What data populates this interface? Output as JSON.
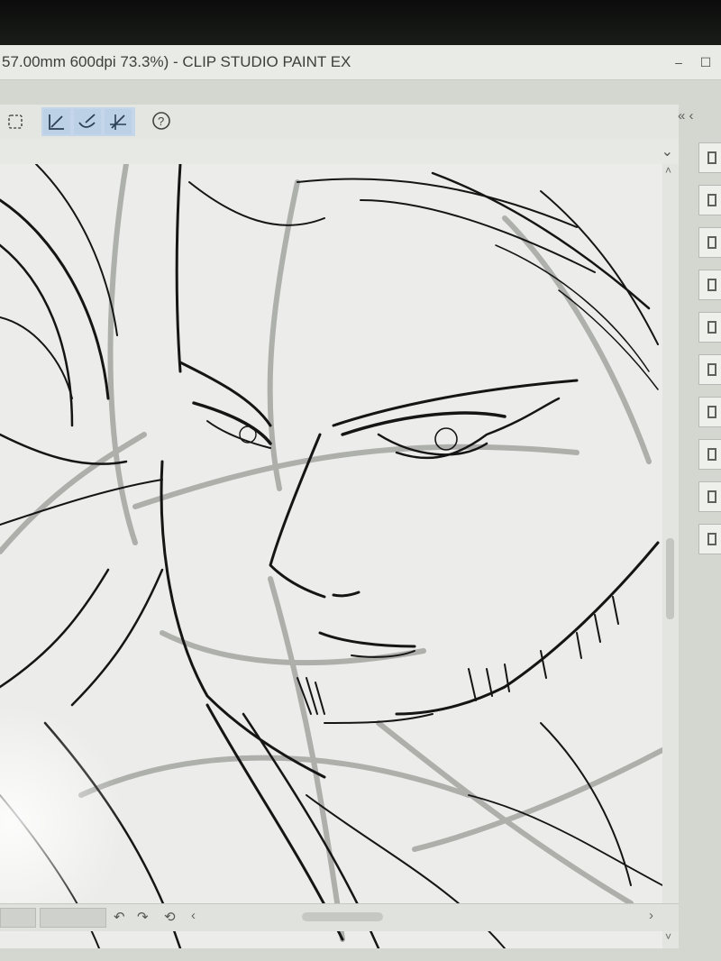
{
  "window": {
    "title": "57.00mm 600dpi 73.3%)  - CLIP STUDIO PAINT EX",
    "minimize_glyph": "–",
    "maximize_glyph": "☐"
  },
  "toolbar": {
    "buttons": [
      {
        "name": "selection-area-icon"
      },
      {
        "name": "ruler-snap-icon"
      },
      {
        "name": "special-ruler-snap-icon"
      },
      {
        "name": "grid-snap-icon"
      },
      {
        "name": "help-icon"
      }
    ],
    "collapse_glyph": "«  ‹"
  },
  "canvas_header": {
    "dropdown_glyph": "⌄"
  },
  "bottom_bar": {
    "rotate_left_glyph": "↶",
    "rotate_right_glyph": "↷",
    "reset_glyph": "⟲",
    "scroll_left_glyph": "‹",
    "scroll_right_glyph": "›"
  },
  "scroll": {
    "up_glyph": "˄",
    "down_glyph": "˅"
  },
  "sidebar": {
    "buttons": [
      "palette-1",
      "palette-2",
      "palette-3",
      "palette-4",
      "palette-5",
      "palette-6",
      "palette-7",
      "palette-8",
      "palette-9",
      "palette-10"
    ]
  },
  "colors": {
    "selected_tool_bg": "#c5d6ea",
    "canvas_bg": "#ecedea",
    "ink": "#151515",
    "sketch": "#9a9b97"
  }
}
